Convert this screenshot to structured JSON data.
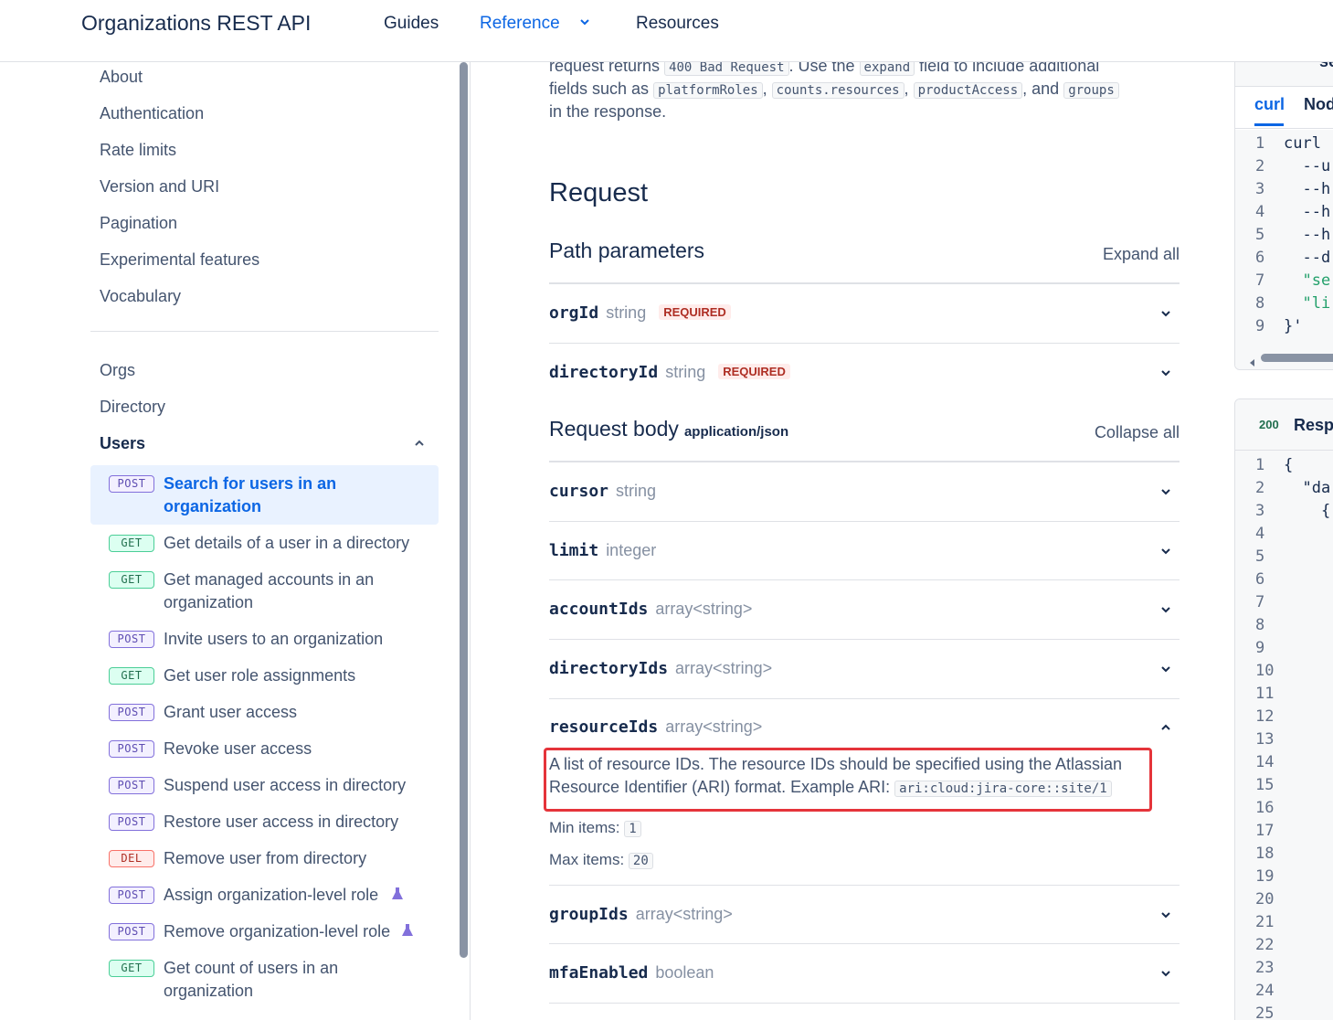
{
  "header": {
    "brand": "Organizations REST API",
    "nav": [
      "Guides",
      "Reference",
      "Resources"
    ],
    "active_nav": "Reference"
  },
  "sidebar": {
    "intro_links": [
      "About",
      "Authentication",
      "Rate limits",
      "Version and URI",
      "Pagination",
      "Experimental features",
      "Vocabulary"
    ],
    "groups": [
      "Orgs",
      "Directory",
      "Users"
    ],
    "operations": [
      {
        "method": "POST",
        "label": "Search for users in an organization",
        "active": true
      },
      {
        "method": "GET",
        "label": "Get details of a user in a directory"
      },
      {
        "method": "GET",
        "label": "Get managed accounts in an organization"
      },
      {
        "method": "POST",
        "label": "Invite users to an organization"
      },
      {
        "method": "GET",
        "label": "Get user role assignments"
      },
      {
        "method": "POST",
        "label": "Grant user access"
      },
      {
        "method": "POST",
        "label": "Revoke user access"
      },
      {
        "method": "POST",
        "label": "Suspend user access in directory"
      },
      {
        "method": "POST",
        "label": "Restore user access in directory"
      },
      {
        "method": "DEL",
        "label": "Remove user from directory"
      },
      {
        "method": "POST",
        "label": "Assign organization-level role",
        "experimental": true
      },
      {
        "method": "POST",
        "label": "Remove organization-level role",
        "experimental": true
      },
      {
        "method": "GET",
        "label": "Get count of users in an organization"
      }
    ]
  },
  "main": {
    "intro": {
      "line1_a": "request returns ",
      "code_400": "400 Bad Request",
      "line1_b": ". Use the ",
      "code_expand": "expand",
      "line1_c": " field to include additional",
      "line2_a": "fields such as ",
      "code_platformRoles": "platformRoles",
      "comma": ",",
      "code_counts": "counts.resources",
      "code_productAccess": "productAccess",
      "and": ", and ",
      "code_groups": "groups",
      "line3": "in the response."
    },
    "request_title": "Request",
    "path_params_title": "Path parameters",
    "expand_all": "Expand all",
    "path_params": [
      {
        "name": "orgId",
        "type": "string",
        "required": "REQUIRED"
      },
      {
        "name": "directoryId",
        "type": "string",
        "required": "REQUIRED"
      }
    ],
    "request_body_title": "Request body",
    "request_body_type": "application/json",
    "collapse_all": "Collapse all",
    "body_params": [
      {
        "name": "cursor",
        "type": "string"
      },
      {
        "name": "limit",
        "type": "integer"
      },
      {
        "name": "accountIds",
        "type": "array<string>"
      },
      {
        "name": "directoryIds",
        "type": "array<string>"
      },
      {
        "name": "resourceIds",
        "type": "array<string>"
      },
      {
        "name": "groupIds",
        "type": "array<string>"
      },
      {
        "name": "mfaEnabled",
        "type": "boolean"
      }
    ],
    "resource_desc_1": "A list of resource IDs. The resource IDs should be specified using the Atlassian",
    "resource_desc_2": "Resource Identifier (ARI) format. Example ARI: ",
    "resource_ari": "ari:cloud:jira-core::site/1",
    "min_items_label": "Min items: ",
    "min_items": "1",
    "max_items_label": "Max items: ",
    "max_items": "20"
  },
  "code_panel": {
    "title_fragment": "se",
    "tabs": [
      "curl",
      "Nod"
    ],
    "lines": [
      "curl -",
      "  --u",
      "  --h",
      "  --h",
      "  --h",
      "  --d",
      "  \"se",
      "  \"li",
      "}'"
    ]
  },
  "response_panel": {
    "status": "200",
    "title": "Resp",
    "lines": [
      "{",
      "  \"da",
      "    {"
    ],
    "line_count": 25
  }
}
